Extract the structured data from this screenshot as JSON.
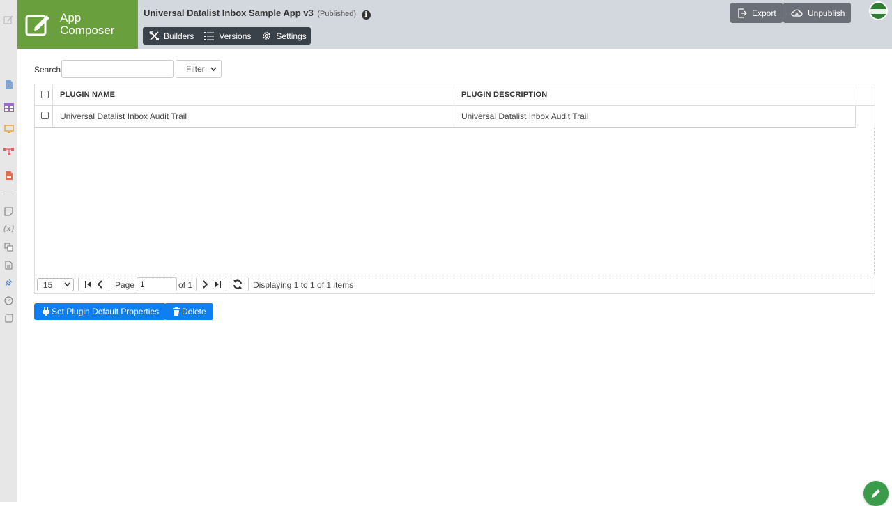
{
  "header": {
    "brand_line1": "App",
    "brand_line2": "Composer",
    "app_name": "Universal Datalist Inbox Sample App v3",
    "app_status": "(Published)",
    "tabs": [
      {
        "label": "Builders",
        "icon": "builders-icon"
      },
      {
        "label": "Versions",
        "icon": "list-icon"
      },
      {
        "label": "Settings",
        "icon": "gear-icon"
      }
    ],
    "export_label": "Export",
    "unpublish_label": "Unpublish"
  },
  "search": {
    "label": "Search",
    "value": "",
    "filter_selected": "Filter"
  },
  "table": {
    "columns": [
      "PLUGIN NAME",
      "PLUGIN DESCRIPTION"
    ],
    "rows": [
      {
        "name": "Universal Datalist Inbox Audit Trail",
        "description": "Universal Datalist Inbox Audit Trail"
      }
    ]
  },
  "pager": {
    "page_size": "15",
    "page_label": "Page",
    "page_value": "1",
    "of_label": "of 1",
    "display_text": "Displaying 1 to 1 of 1 items"
  },
  "actions": {
    "set_default_label": "Set Plugin Default Properties",
    "delete_label": "Delete"
  },
  "colors": {
    "brand": "#6a9f3e",
    "primary_button": "#0d7ff2",
    "header_bg": "#d3d8de",
    "tabs_bg": "#3b4149"
  }
}
